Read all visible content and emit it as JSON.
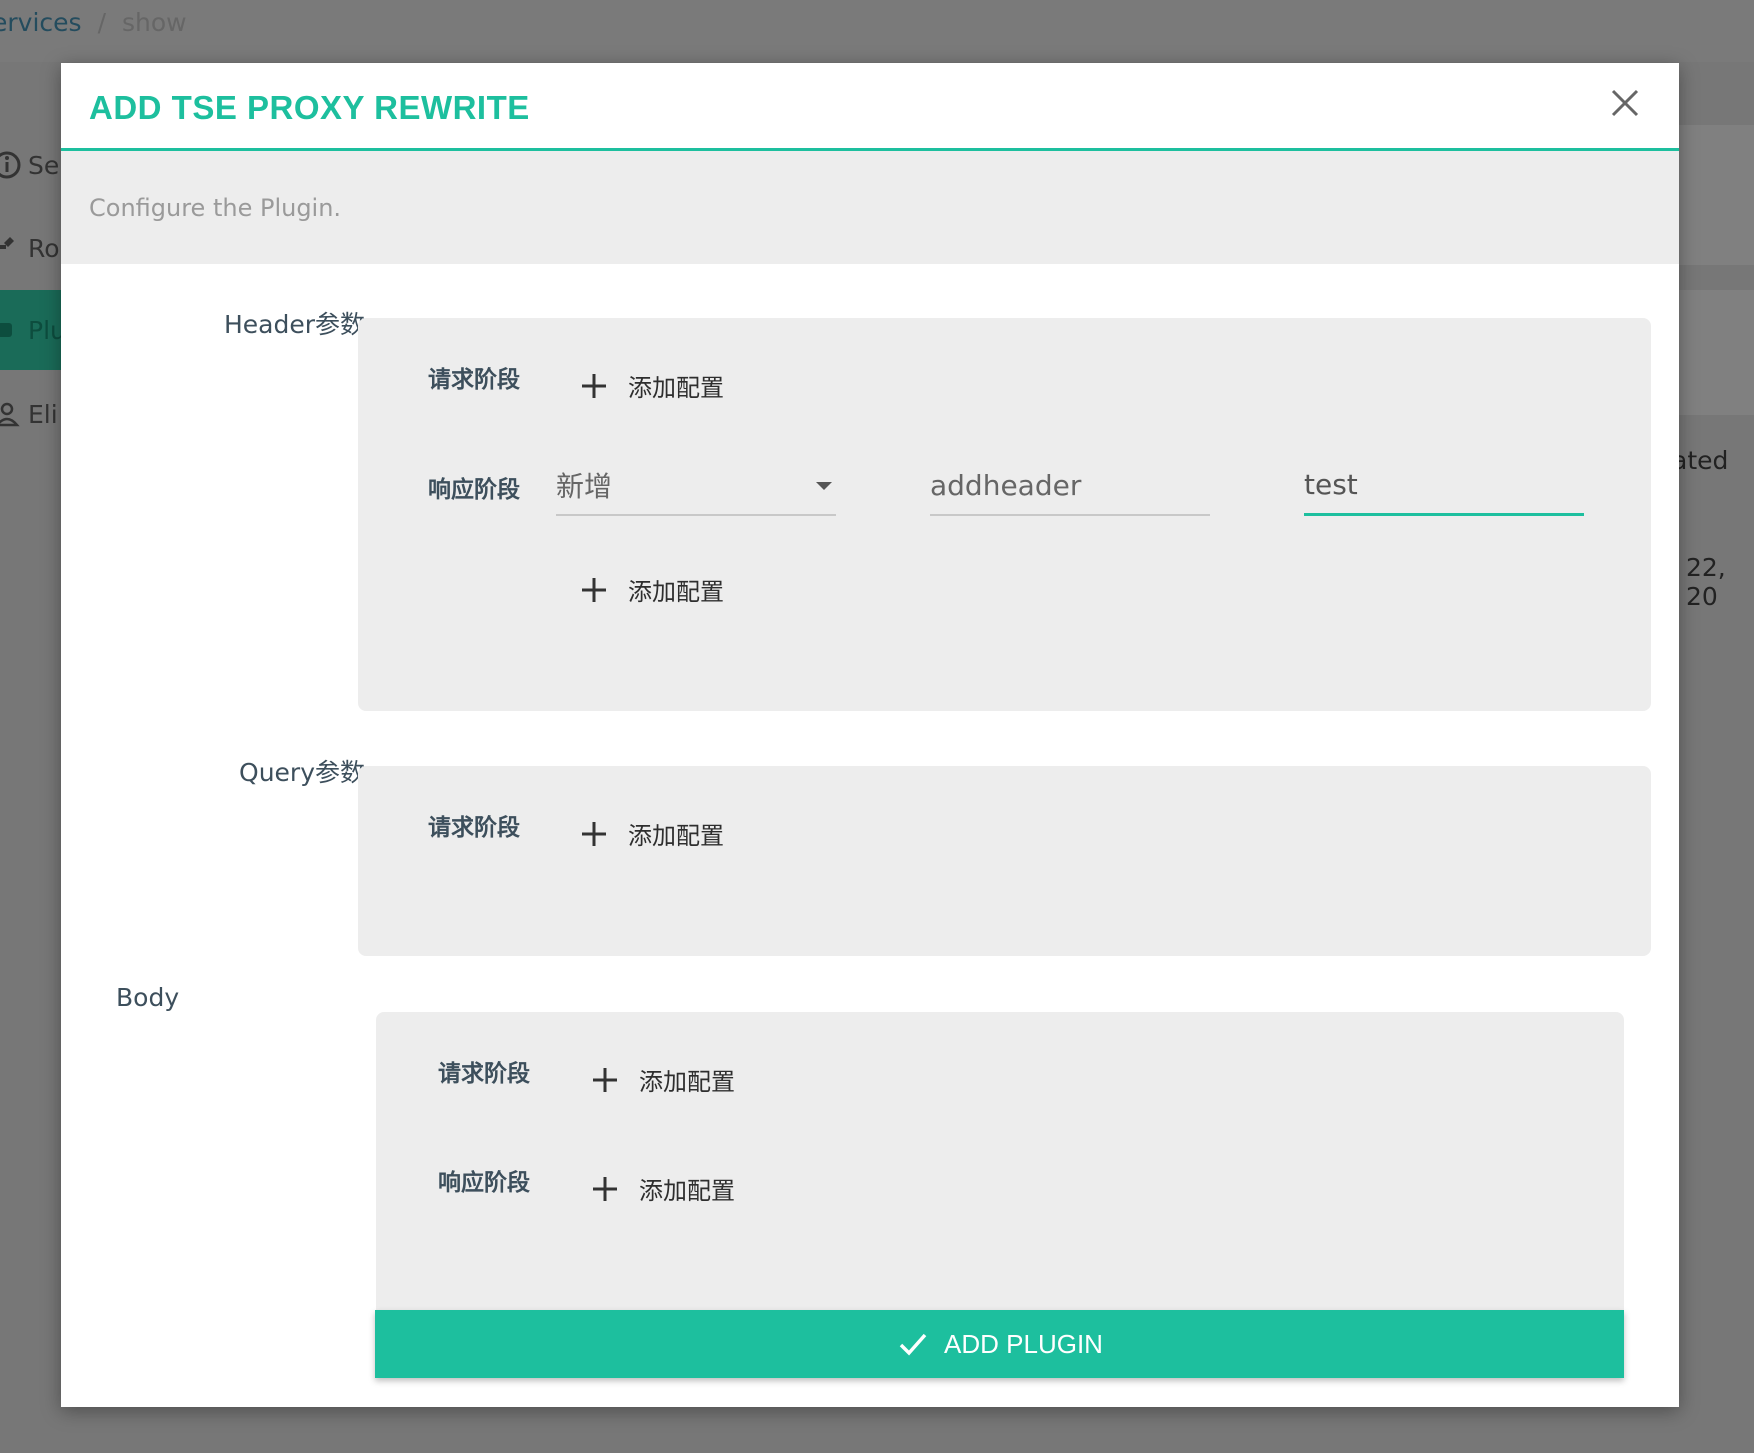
{
  "breadcrumb": {
    "link": "ervices",
    "separator": "/",
    "current": "show"
  },
  "background": {
    "sidebar": [
      "Se",
      "Ro",
      "Plu",
      "Eli"
    ],
    "table_header_fragment": "ated",
    "date_fragment": "22, 20"
  },
  "modal": {
    "title": "ADD TSE PROXY REWRITE",
    "subtitle": "Configure the Plugin.",
    "sections": {
      "header": {
        "label": "Header参数",
        "request_stage": "请求阶段",
        "response_stage": "响应阶段",
        "add_config": "添加配置",
        "response_row": {
          "action": "新增",
          "key": "addheader",
          "value": "test"
        }
      },
      "query": {
        "label": "Query参数",
        "request_stage": "请求阶段",
        "add_config": "添加配置"
      },
      "body": {
        "label": "Body",
        "request_stage": "请求阶段",
        "response_stage": "响应阶段",
        "add_config": "添加配置"
      }
    },
    "submit_label": "ADD PLUGIN"
  },
  "colors": {
    "accent": "#1dbf9e",
    "panel": "#ededed",
    "label": "#3d4f5c"
  }
}
